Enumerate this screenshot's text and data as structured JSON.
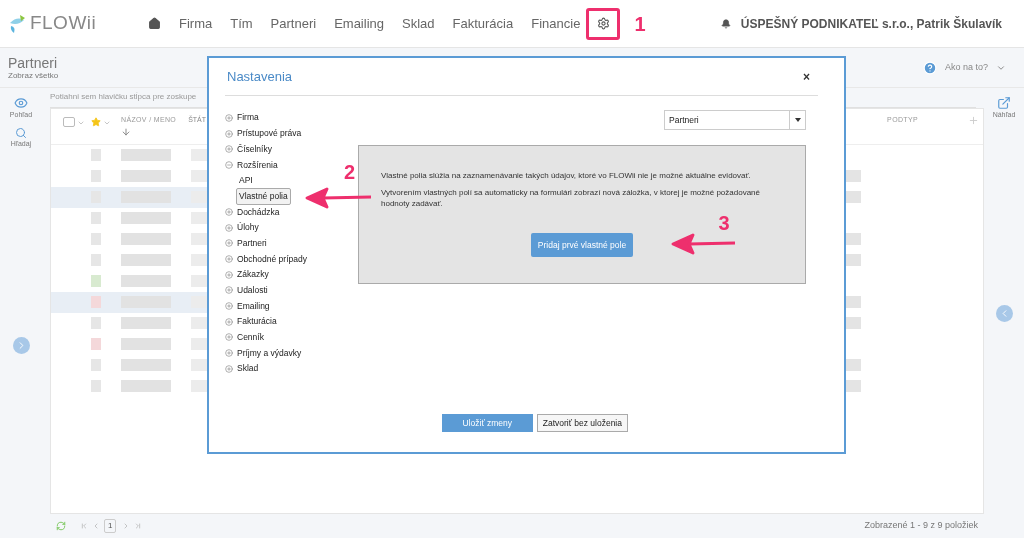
{
  "brand": {
    "name": "FLOWii"
  },
  "nav": [
    {
      "label": "Firma"
    },
    {
      "label": "Tím"
    },
    {
      "label": "Partneri"
    },
    {
      "label": "Emailing"
    },
    {
      "label": "Sklad"
    },
    {
      "label": "Fakturácia"
    },
    {
      "label": "Financie"
    }
  ],
  "user": "ÚSPEŠNÝ PODNIKATEĽ s.r.o., Patrik Škulavík",
  "page": {
    "title": "Partneri",
    "subtitle": "Zobraz všetko",
    "help": "Ako na to?"
  },
  "left_rail": [
    {
      "label": "Pohľad"
    },
    {
      "label": "Hľadaj"
    }
  ],
  "right_rail": {
    "label": "Náhľad"
  },
  "grid": {
    "select_all": {
      "checked": false
    },
    "group_hint": "Potiahni sem hlavičku stĺpca pre zoskupe",
    "columns": [
      "NÁZOV / MENO",
      "ŠTÁT",
      "PODTYP"
    ],
    "page": "1",
    "summary": "Zobrazené 1 - 9 z 9 položiek"
  },
  "dialog": {
    "title": "Nastavenia",
    "close": "×",
    "tree": [
      {
        "label": "Firma",
        "expanded": false
      },
      {
        "label": "Prístupové práva",
        "expanded": false
      },
      {
        "label": "Číselníky",
        "expanded": false
      },
      {
        "label": "Rozšírenia",
        "expanded": true,
        "children": [
          {
            "label": "API",
            "selected": false
          },
          {
            "label": "Vlastné polia",
            "selected": true
          }
        ]
      },
      {
        "label": "Dochádzka",
        "expanded": false
      },
      {
        "label": "Úlohy",
        "expanded": false
      },
      {
        "label": "Partneri",
        "expanded": false
      },
      {
        "label": "Obchodné prípady",
        "expanded": false
      },
      {
        "label": "Zákazky",
        "expanded": false
      },
      {
        "label": "Udalosti",
        "expanded": false
      },
      {
        "label": "Emailing",
        "expanded": false
      },
      {
        "label": "Fakturácia",
        "expanded": false
      },
      {
        "label": "Cenník",
        "expanded": false
      },
      {
        "label": "Príjmy a výdavky",
        "expanded": false
      },
      {
        "label": "Sklad",
        "expanded": false
      }
    ],
    "select": {
      "value": "Partneri"
    },
    "info": [
      "Vlastné polia slúžia na zaznamenávanie takých údajov, ktoré vo FLOWii nie je možné aktuálne evidovať.",
      "Vytvorením vlastných polí sa automaticky na formulári zobrazí nová záložka, v ktorej je možné požadované hodnoty zadávať."
    ],
    "add_button": "Pridaj prvé vlastné pole",
    "buttons": [
      "Uložiť zmeny",
      "Zatvoriť bez uloženia"
    ]
  },
  "annotations": [
    "1",
    "2",
    "3"
  ]
}
